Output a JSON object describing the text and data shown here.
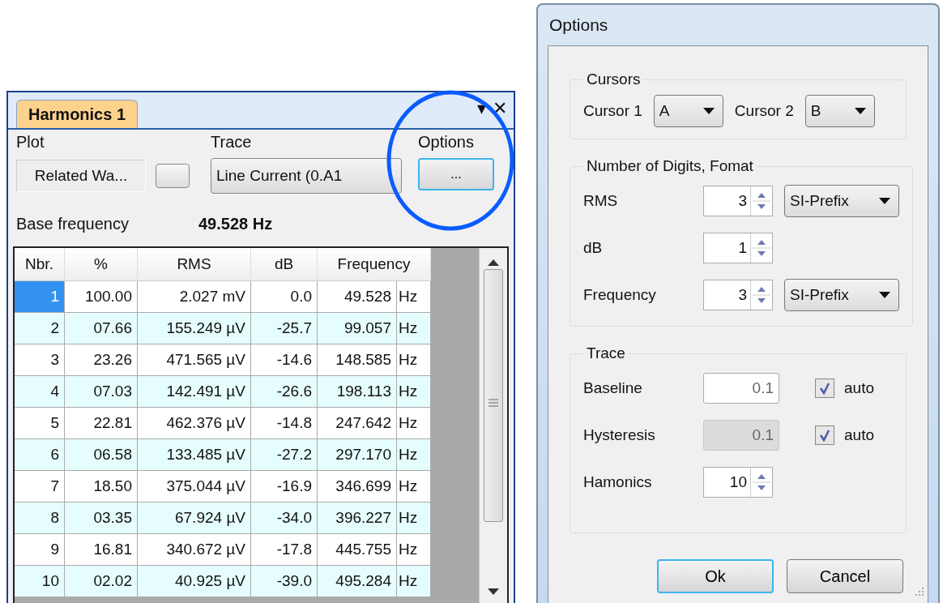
{
  "panel": {
    "tab": {
      "label": "Harmonics 1",
      "selected": true
    },
    "menu_glyph": "▾",
    "close_glyph": "✕",
    "plot": {
      "label": "Plot",
      "value": "Related Wa..."
    },
    "trace": {
      "label": "Trace",
      "value": "Line Current (0.A1"
    },
    "options": {
      "label": "Options",
      "button": "..."
    },
    "base_frequency": {
      "label": "Base frequency",
      "value": "49.528 Hz"
    },
    "table": {
      "columns": [
        "Nbr.",
        "%",
        "RMS",
        "dB",
        "Frequency"
      ],
      "rows": [
        {
          "selected": true,
          "cells": [
            "1",
            "100.00",
            "2.027 mV",
            "0.0",
            "49.528",
            "Hz"
          ]
        },
        {
          "selected": false,
          "cells": [
            "2",
            "07.66",
            "155.249 µV",
            "-25.7",
            "99.057",
            "Hz"
          ]
        },
        {
          "selected": false,
          "cells": [
            "3",
            "23.26",
            "471.565 µV",
            "-14.6",
            "148.585",
            "Hz"
          ]
        },
        {
          "selected": false,
          "cells": [
            "4",
            "07.03",
            "142.491 µV",
            "-26.6",
            "198.113",
            "Hz"
          ]
        },
        {
          "selected": false,
          "cells": [
            "5",
            "22.81",
            "462.376 µV",
            "-14.8",
            "247.642",
            "Hz"
          ]
        },
        {
          "selected": false,
          "cells": [
            "6",
            "06.58",
            "133.485 µV",
            "-27.2",
            "297.170",
            "Hz"
          ]
        },
        {
          "selected": false,
          "cells": [
            "7",
            "18.50",
            "375.044 µV",
            "-16.9",
            "346.699",
            "Hz"
          ]
        },
        {
          "selected": false,
          "cells": [
            "8",
            "03.35",
            "67.924 µV",
            "-34.0",
            "396.227",
            "Hz"
          ]
        },
        {
          "selected": false,
          "cells": [
            "9",
            "16.81",
            "340.672 µV",
            "-17.8",
            "445.755",
            "Hz"
          ]
        },
        {
          "selected": false,
          "cells": [
            "10",
            "02.02",
            "40.925 µV",
            "-39.0",
            "495.284",
            "Hz"
          ]
        }
      ]
    }
  },
  "dialog": {
    "title": "Options",
    "cursors": {
      "title": "Cursors",
      "items": [
        {
          "label": "Cursor 1",
          "value": "A"
        },
        {
          "label": "Cursor 2",
          "value": "B"
        }
      ]
    },
    "digits": {
      "title": "Number of Digits, Fomat",
      "rows": [
        {
          "label": "RMS",
          "value": "3",
          "format": "SI-Prefix"
        },
        {
          "label": "dB",
          "value": "1"
        },
        {
          "label": "Frequency",
          "value": "3",
          "format": "SI-Prefix"
        }
      ]
    },
    "trace": {
      "title": "Trace",
      "rows": [
        {
          "kind": "text",
          "label": "Baseline",
          "value": "0.1",
          "disabled": false,
          "checkbox": {
            "label": "auto",
            "checked": true
          }
        },
        {
          "kind": "text",
          "label": "Hysteresis",
          "value": "0.1",
          "disabled": true,
          "checkbox": {
            "label": "auto",
            "checked": true
          }
        },
        {
          "kind": "spinner",
          "label": "Hamonics",
          "value": "10"
        }
      ]
    },
    "buttons": [
      {
        "label": "Ok",
        "default": true
      },
      {
        "label": "Cancel",
        "default": false
      }
    ]
  }
}
